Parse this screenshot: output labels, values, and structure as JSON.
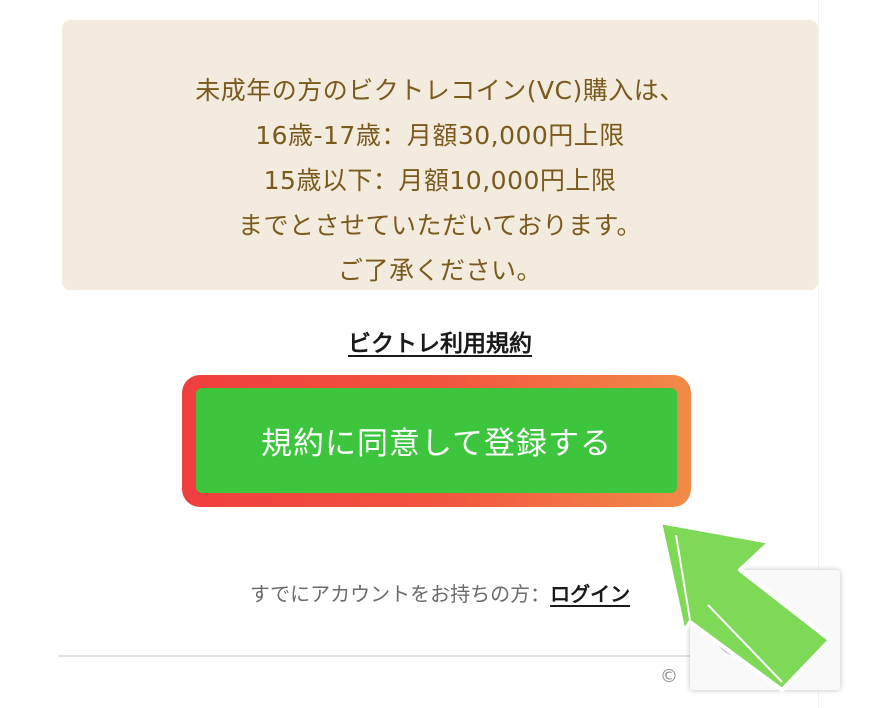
{
  "notice": {
    "lines": [
      "未成年の方のビクトレコイン(VC)購入は、",
      "16歳-17歳：月額30,000円上限",
      "15歳以下：月額10,000円上限",
      "までとさせていただいております。",
      "ご了承ください。"
    ]
  },
  "terms": {
    "link_label": "ビクトレ利用規約"
  },
  "cta": {
    "label": "規約に同意して登録する"
  },
  "login": {
    "prompt": "すでにアカウントをお持ちの方：",
    "link_label": "ログイン"
  },
  "footer": {
    "copyright_symbol": "©"
  },
  "icons": {
    "pointer_arrow": "arrow-up-left-icon",
    "recaptcha": "recaptcha-icon"
  },
  "colors": {
    "notice_bg": "#f3ebdd",
    "notice_text": "#7a5a1e",
    "cta_green": "#3dc63d",
    "highlight_red": "#ef3e3e",
    "highlight_orange": "#f18b47",
    "arrow_green": "#7ed957"
  }
}
